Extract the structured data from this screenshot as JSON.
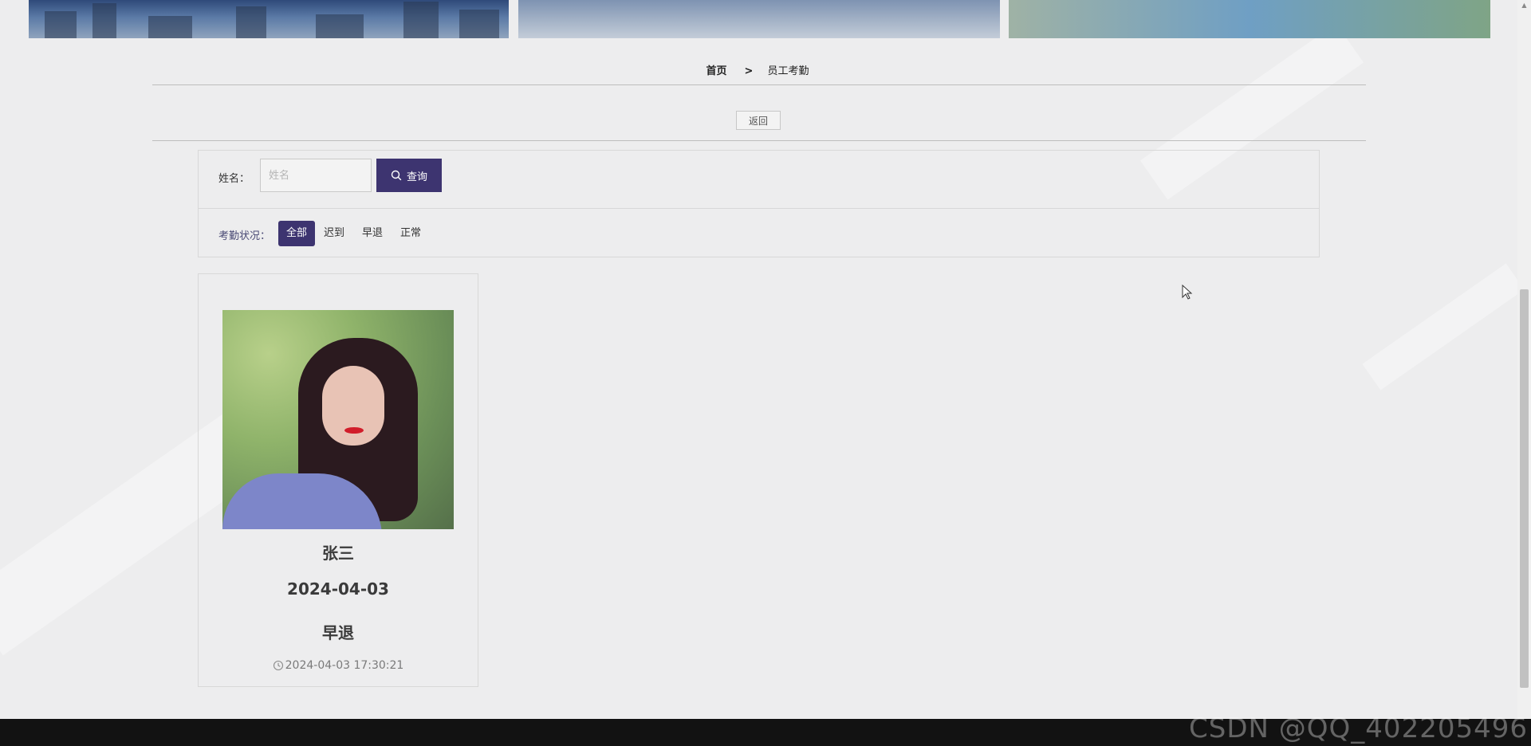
{
  "breadcrumb": {
    "home": "首页",
    "separator": ">",
    "current": "员工考勤"
  },
  "back_button": {
    "label": "返回"
  },
  "filter": {
    "name_label": "姓名：",
    "name_placeholder": "姓名",
    "name_value": "",
    "search_label": "查询",
    "status_label": "考勤状况：",
    "status_options": [
      "全部",
      "迟到",
      "早退",
      "正常"
    ],
    "status_selected": "全部"
  },
  "records": [
    {
      "name": "张三",
      "date": "2024-04-03",
      "status": "早退",
      "timestamp": "2024-04-03 17:30:21"
    }
  ],
  "watermark": "CSDN @QQ_402205496",
  "colors": {
    "accent": "#3d3470",
    "background": "#ededee",
    "footer": "#121212"
  }
}
